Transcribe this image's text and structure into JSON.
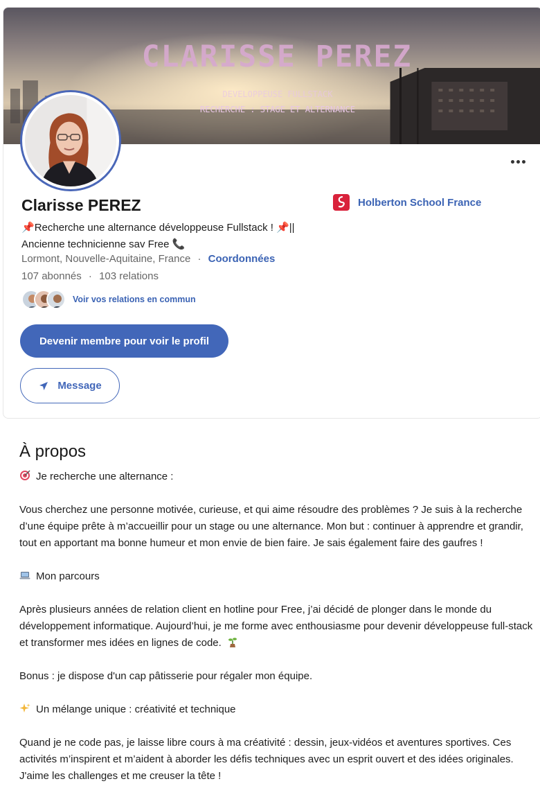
{
  "banner": {
    "title": "CLARISSE PEREZ",
    "subtitle_1": "DEVELOPPEUSE FULLSTACK",
    "subtitle_2": "RECHERCHE : STAGE ET ALTERNANCE"
  },
  "profile": {
    "name": "Clarisse PEREZ",
    "headline_line1": "Recherche une alternance développeuse Fullstack !",
    "headline_sep": "||",
    "headline_line2": "Ancienne technicienne sav Free",
    "location": "Lormont, Nouvelle-Aquitaine, France",
    "location_sep": "·",
    "contact_link": "Coordonnées",
    "followers": "107 abonnés",
    "stats_sep": "·",
    "connections": "103 relations",
    "school": "Holberton School France",
    "mutual_label": "Voir vos relations en commun"
  },
  "actions": {
    "join_label": "Devenir membre pour voir le profil",
    "message_label": "Message"
  },
  "about": {
    "title": "À propos",
    "p1": "Je recherche une alternance :",
    "p2": "Vous cherchez une personne motivée, curieuse, et qui aime résoudre des problèmes ? Je suis à la recherche d’une équipe prête à m’accueillir pour un stage ou une alternance. Mon but : continuer à apprendre et grandir, tout en apportant ma bonne humeur et mon envie de bien faire. Je sais également faire des gaufres !",
    "p3": "Mon parcours",
    "p4": "Après plusieurs années de relation client en hotline pour Free, j’ai décidé de plonger dans le monde du développement informatique. Aujourd’hui, je me forme avec enthousiasme pour devenir développeuse full-stack et transformer mes idées en lignes de code.",
    "p5": "Bonus : je dispose d'un cap pâtisserie pour régaler mon équipe.",
    "p6": "Un mélange unique : créativité et technique",
    "p7": "Quand je ne code pas, je laisse libre cours à ma créativité : dessin, jeux-vidéos et aventures sportives. Ces activités m’inspirent et m’aident à aborder les défis techniques avec un esprit ouvert et des idées originales. J'aime les challenges et me creuser la tête !"
  },
  "icons": [
    "pin-icon",
    "phone-icon",
    "target-icon",
    "laptop-icon",
    "sprout-icon",
    "sparkles-icon",
    "send-icon",
    "more-icon",
    "school-logo-icon"
  ],
  "colors": {
    "accent": "#4267b9",
    "link": "#3b63b4",
    "school_logo": "#d9223b"
  }
}
